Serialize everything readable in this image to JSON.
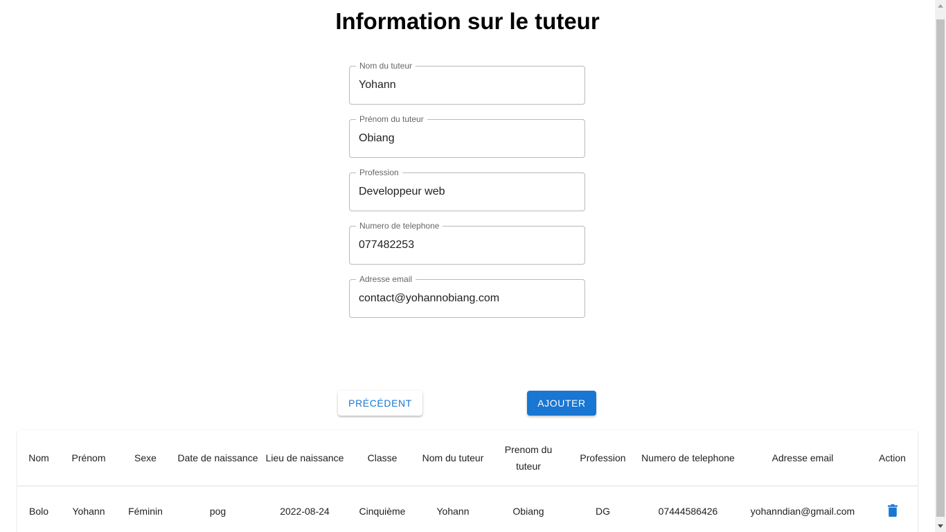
{
  "page": {
    "title": "Information sur le tuteur"
  },
  "form": {
    "fields": [
      {
        "label": "Nom du tuteur",
        "value": "Yohann"
      },
      {
        "label": "Prénom du tuteur",
        "value": "Obiang"
      },
      {
        "label": "Profession",
        "value": "Developpeur web"
      },
      {
        "label": "Numero de telephone",
        "value": "077482253"
      },
      {
        "label": "Adresse email",
        "value": "contact@yohannobiang.com"
      }
    ]
  },
  "actions": {
    "previous_label": "PRÉCÉDENT",
    "add_label": "AJOUTER"
  },
  "table": {
    "headers": [
      "Nom",
      "Prénom",
      "Sexe",
      "Date de naissance",
      "Lieu de naissance",
      "Classe",
      "Nom du tuteur",
      "Prenom du tuteur",
      "Profession",
      "Numero de telephone",
      "Adresse email",
      "Action"
    ],
    "rows": [
      {
        "cells": [
          "Bolo",
          "Yohann",
          "Féminin",
          "pog",
          "2022-08-24",
          "Cinquième",
          "Yohann",
          "Obiang",
          "DG",
          "07444586426",
          "yohanndian@gmail.com"
        ],
        "action_icon": "trash-icon"
      }
    ]
  },
  "colors": {
    "primary": "#1976d2",
    "border": "#b9b9b9",
    "scrollbar_thumb": "#c1c1c1"
  }
}
